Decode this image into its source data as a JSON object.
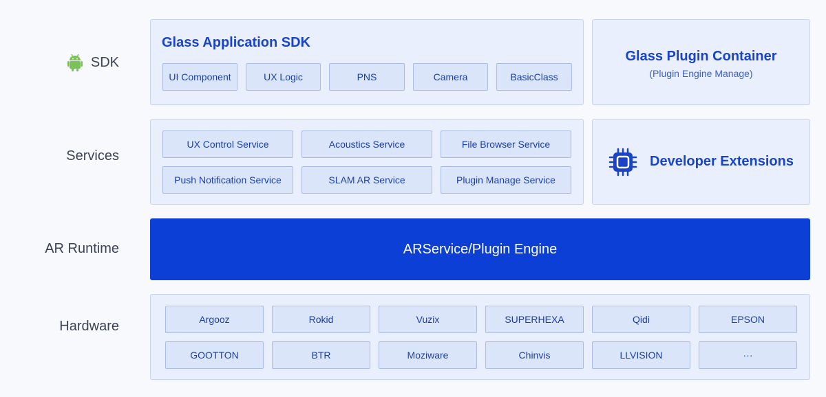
{
  "rows": {
    "sdk": "SDK",
    "services": "Services",
    "runtime": "AR Runtime",
    "hardware": "Hardware"
  },
  "sdk_panel": {
    "title": "Glass Application SDK",
    "items": [
      "UI Component",
      "UX Logic",
      "PNS",
      "Camera",
      "BasicClass"
    ]
  },
  "plugin_container": {
    "title": "Glass Plugin Container",
    "subtitle": "(Plugin Engine Manage)"
  },
  "services_panel": {
    "items": [
      "UX  Control Service",
      "Acoustics Service",
      "File Browser Service",
      "Push Notification Service",
      "SLAM AR Service",
      "Plugin Manage Service"
    ]
  },
  "developer_extensions": {
    "label": "Developer Extensions",
    "icon": "chip-icon"
  },
  "runtime": {
    "label": "ARService/Plugin Engine"
  },
  "hardware_panel": {
    "items": [
      "Argooz",
      "Rokid",
      "Vuzix",
      "SUPERHEXA",
      "Qidi",
      "EPSON",
      "GOOTTON",
      "BTR",
      "Moziware",
      "Chinvis",
      "LLVISION",
      "···"
    ]
  },
  "colors": {
    "accent": "#0c3fd6",
    "title_text": "#1a44c8",
    "panel_bg": "#e9effc",
    "chip_bg": "#dbe5fa",
    "android_green": "#78c257"
  }
}
